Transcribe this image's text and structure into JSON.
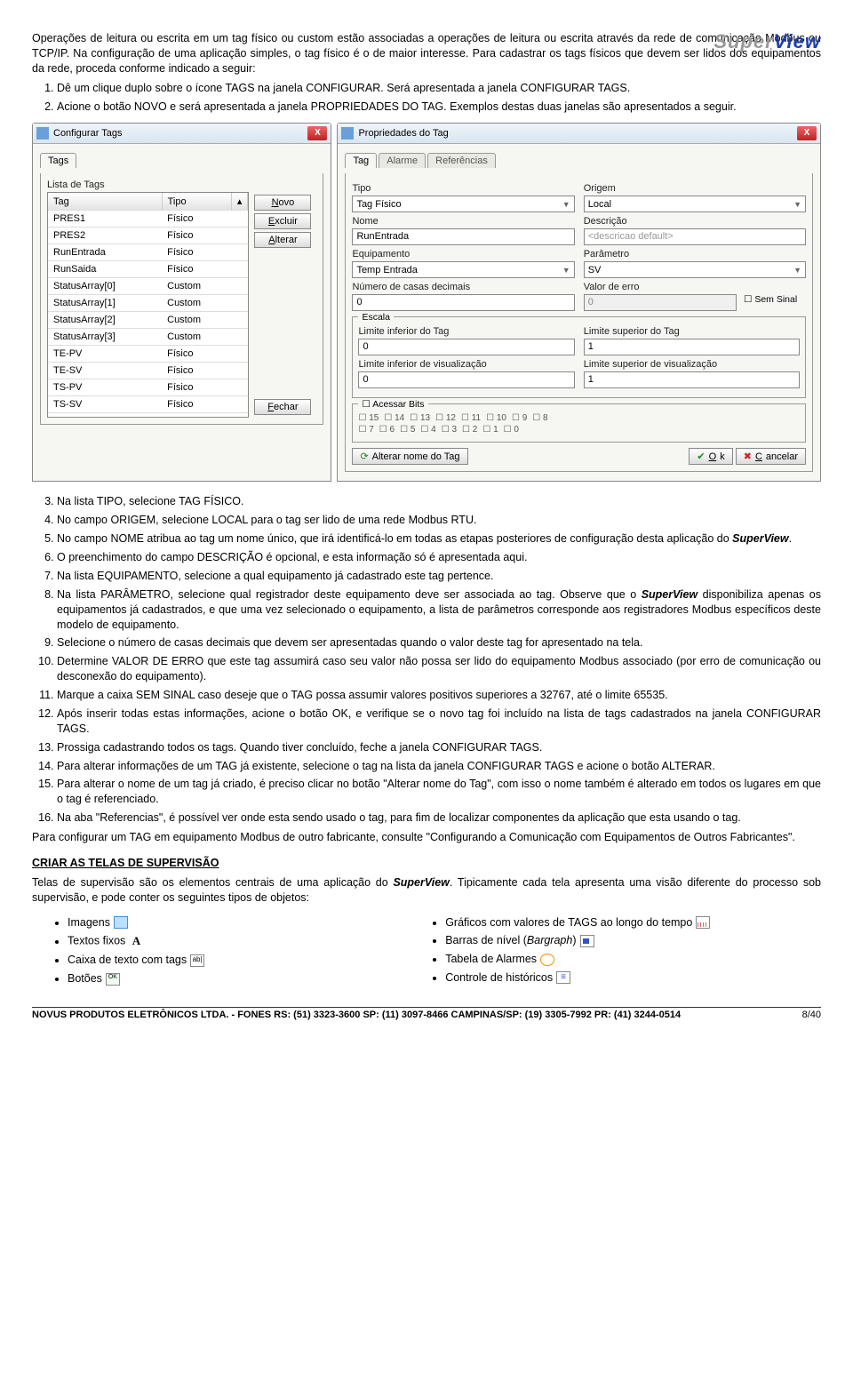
{
  "brand": {
    "s1": "Super",
    "s2": "View"
  },
  "intro": {
    "p": "Operações de leitura ou escrita em um tag físico ou custom estão associadas a operações de leitura ou escrita através da rede de comunicação Modbus ou TCP/IP. Na configuração de uma aplicação simples, o tag físico é o de maior interesse. Para cadastrar os tags físicos que devem ser lidos dos equipamentos da rede, proceda conforme indicado a seguir:",
    "li1": "Dê um clique duplo sobre o ícone TAGS na janela CONFIGURAR. Será apresentada a janela CONFIGURAR TAGS.",
    "li2": "Acione o botão NOVO e será apresentada a janela PROPRIEDADES DO TAG. Exemplos destas duas janelas são apresentados a seguir."
  },
  "win1": {
    "title": "Configurar Tags",
    "tab": "Tags",
    "listLabel": "Lista de Tags",
    "colTag": "Tag",
    "colTipo": "Tipo",
    "rows": [
      {
        "t": "PRES1",
        "k": "Físico"
      },
      {
        "t": "PRES2",
        "k": "Físico"
      },
      {
        "t": "RunEntrada",
        "k": "Físico"
      },
      {
        "t": "RunSaida",
        "k": "Físico"
      },
      {
        "t": "StatusArray[0]",
        "k": "Custom"
      },
      {
        "t": "StatusArray[1]",
        "k": "Custom"
      },
      {
        "t": "StatusArray[2]",
        "k": "Custom"
      },
      {
        "t": "StatusArray[3]",
        "k": "Custom"
      },
      {
        "t": "TE-PV",
        "k": "Físico"
      },
      {
        "t": "TE-SV",
        "k": "Físico"
      },
      {
        "t": "TS-PV",
        "k": "Físico"
      },
      {
        "t": "TS-SV",
        "k": "Físico"
      }
    ],
    "btnNovo": "Novo",
    "btnExcluir": "Excluir",
    "btnAlterar": "Alterar",
    "btnFechar": "Fechar"
  },
  "win2": {
    "title": "Propriedades do Tag",
    "tabs": {
      "t1": "Tag",
      "t2": "Alarme",
      "t3": "Referências"
    },
    "l": {
      "tipo": "Tipo",
      "origem": "Origem",
      "nome": "Nome",
      "desc": "Descrição",
      "equip": "Equipamento",
      "param": "Parâmetro",
      "casas": "Número de casas decimais",
      "erro": "Valor de erro",
      "sem": "Sem Sinal",
      "escala": "Escala",
      "linf": "Limite inferior do Tag",
      "lsup": "Limite superior do Tag",
      "vinf": "Limite inferior de visualização",
      "vsup": "Limite superior de visualização",
      "acessar": "Acessar Bits",
      "altnome": "Alterar nome do Tag",
      "ok": "Ok",
      "cancel": "Cancelar"
    },
    "v": {
      "tipo": "Tag Físico",
      "origem": "Local",
      "nome": "RunEntrada",
      "desc": "<descricao default>",
      "equip": "Temp Entrada",
      "param": "SV",
      "casas": "0",
      "erro": "0",
      "linf": "0",
      "lsup": "1",
      "vinf": "0",
      "vsup": "1"
    },
    "bits1": [
      "15",
      "14",
      "13",
      "12",
      "11",
      "10",
      "9",
      "8"
    ],
    "bits2": [
      "7",
      "6",
      "5",
      "4",
      "3",
      "2",
      "1",
      "0"
    ]
  },
  "post": {
    "li3": "Na lista TIPO, selecione TAG FÍSICO.",
    "li4": "No campo ORIGEM, selecione LOCAL para o tag ser lido de uma rede Modbus RTU.",
    "li5a": "No campo NOME atribua ao tag um nome único, que irá identificá-lo em todas as etapas posteriores de configuração desta aplicação do ",
    "li5b": "SuperView",
    "li5c": ".",
    "li6": "O preenchimento do campo DESCRIÇÃO é opcional, e esta informação só é apresentada aqui.",
    "li7": "Na lista EQUIPAMENTO, selecione a qual equipamento já cadastrado este tag pertence.",
    "li8a": "Na lista PARÂMETRO, selecione qual registrador deste equipamento deve ser associada ao tag. Observe que o ",
    "li8b": "SuperView",
    "li8c": " disponibiliza apenas os equipamentos já cadastrados, e que uma vez selecionado o equipamento, a lista de parâmetros corresponde aos registradores Modbus específicos deste modelo de equipamento.",
    "li9": "Selecione o número de casas decimais que devem ser apresentadas quando o valor deste tag for apresentado na tela.",
    "li10": "Determine VALOR DE ERRO que este tag assumirá caso seu valor não possa ser lido do equipamento Modbus associado (por erro de comunicação ou desconexão do equipamento).",
    "li11": "Marque a caixa SEM SINAL caso deseje que o TAG possa assumir valores positivos superiores a 32767, até o limite 65535.",
    "li12": "Após inserir todas estas informações, acione o botão OK, e verifique se o novo tag foi incluído na lista de tags cadastrados na janela CONFIGURAR TAGS.",
    "li13": "Prossiga cadastrando todos os tags. Quando tiver concluído, feche a janela CONFIGURAR TAGS.",
    "li14": "Para alterar informações de um TAG já existente, selecione o tag na lista da janela CONFIGURAR TAGS e acione o botão ALTERAR.",
    "li15": "Para alterar o nome de um tag já criado, é preciso clicar no botão \"Alterar nome do Tag\", com isso o nome também é alterado em todos os lugares em que o tag é referenciado.",
    "li16": "Na aba \"Referencias\", é possível ver onde esta sendo usado o tag, para fim de localizar componentes da aplicação que esta usando o tag.",
    "pend": "Para configurar um TAG em equipamento Modbus de outro fabricante, consulte \"Configurando a Comunicação com Equipamentos de Outros Fabricantes\"."
  },
  "section": {
    "h": "CRIAR AS TELAS DE SUPERVISÃO",
    "p1a": "Telas de supervisão são os elementos centrais de uma aplicação do ",
    "p1b": "SuperView",
    "p1c": ". Tipicamente cada tela apresenta uma visão diferente do processo sob supervisão, e pode conter os seguintes tipos de objetos:",
    "left": {
      "i1": "Imagens",
      "i2": "Textos fixos",
      "i3": "Caixa de texto com tags",
      "i4": "Botões"
    },
    "right": {
      "i1": "Gráficos com valores de TAGS ao longo do tempo",
      "i2a": "Barras de nível (",
      "i2b": "Bargraph",
      "i2c": ")",
      "i3": "Tabela de Alarmes",
      "i4": "Controle de históricos"
    }
  },
  "footer": {
    "left": "NOVUS PRODUTOS ELETRÔNICOS LTDA. - FONES  RS: (51) 3323-3600  SP: (11) 3097-8466  CAMPINAS/SP: (19) 3305-7992  PR: (41) 3244-0514",
    "page": "8/40"
  }
}
